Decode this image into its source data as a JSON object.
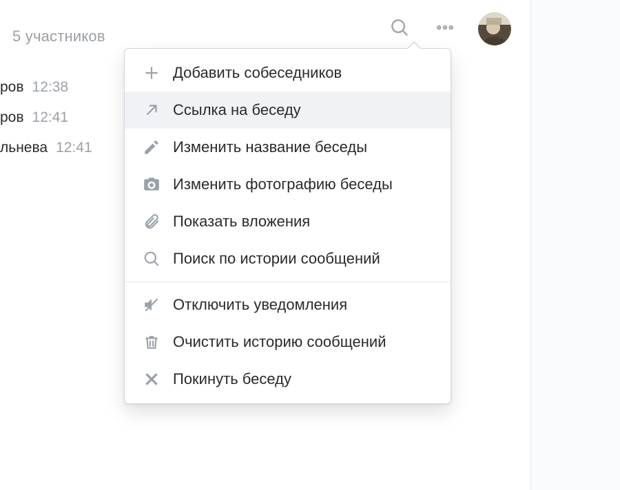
{
  "header": {
    "subtitle": "5 участников"
  },
  "chat_rows": [
    {
      "name_fragment": "ров",
      "time": "12:38"
    },
    {
      "name_fragment": "ров",
      "time": "12:41"
    },
    {
      "name_fragment": "льнева",
      "time": "12:41"
    }
  ],
  "menu": {
    "items": [
      {
        "icon": "plus-icon",
        "label": "Добавить собеседников"
      },
      {
        "icon": "link-arrow-icon",
        "label": "Ссылка на беседу",
        "hover": true
      },
      {
        "icon": "pencil-icon",
        "label": "Изменить название беседы"
      },
      {
        "icon": "camera-icon",
        "label": "Изменить фотографию беседы"
      },
      {
        "icon": "attachment-icon",
        "label": "Показать вложения"
      },
      {
        "icon": "search-icon",
        "label": "Поиск по истории сообщений"
      }
    ],
    "items2": [
      {
        "icon": "mute-icon",
        "label": "Отключить уведомления"
      },
      {
        "icon": "trash-icon",
        "label": "Очистить историю сообщений"
      },
      {
        "icon": "close-icon",
        "label": "Покинуть беседу"
      }
    ]
  }
}
